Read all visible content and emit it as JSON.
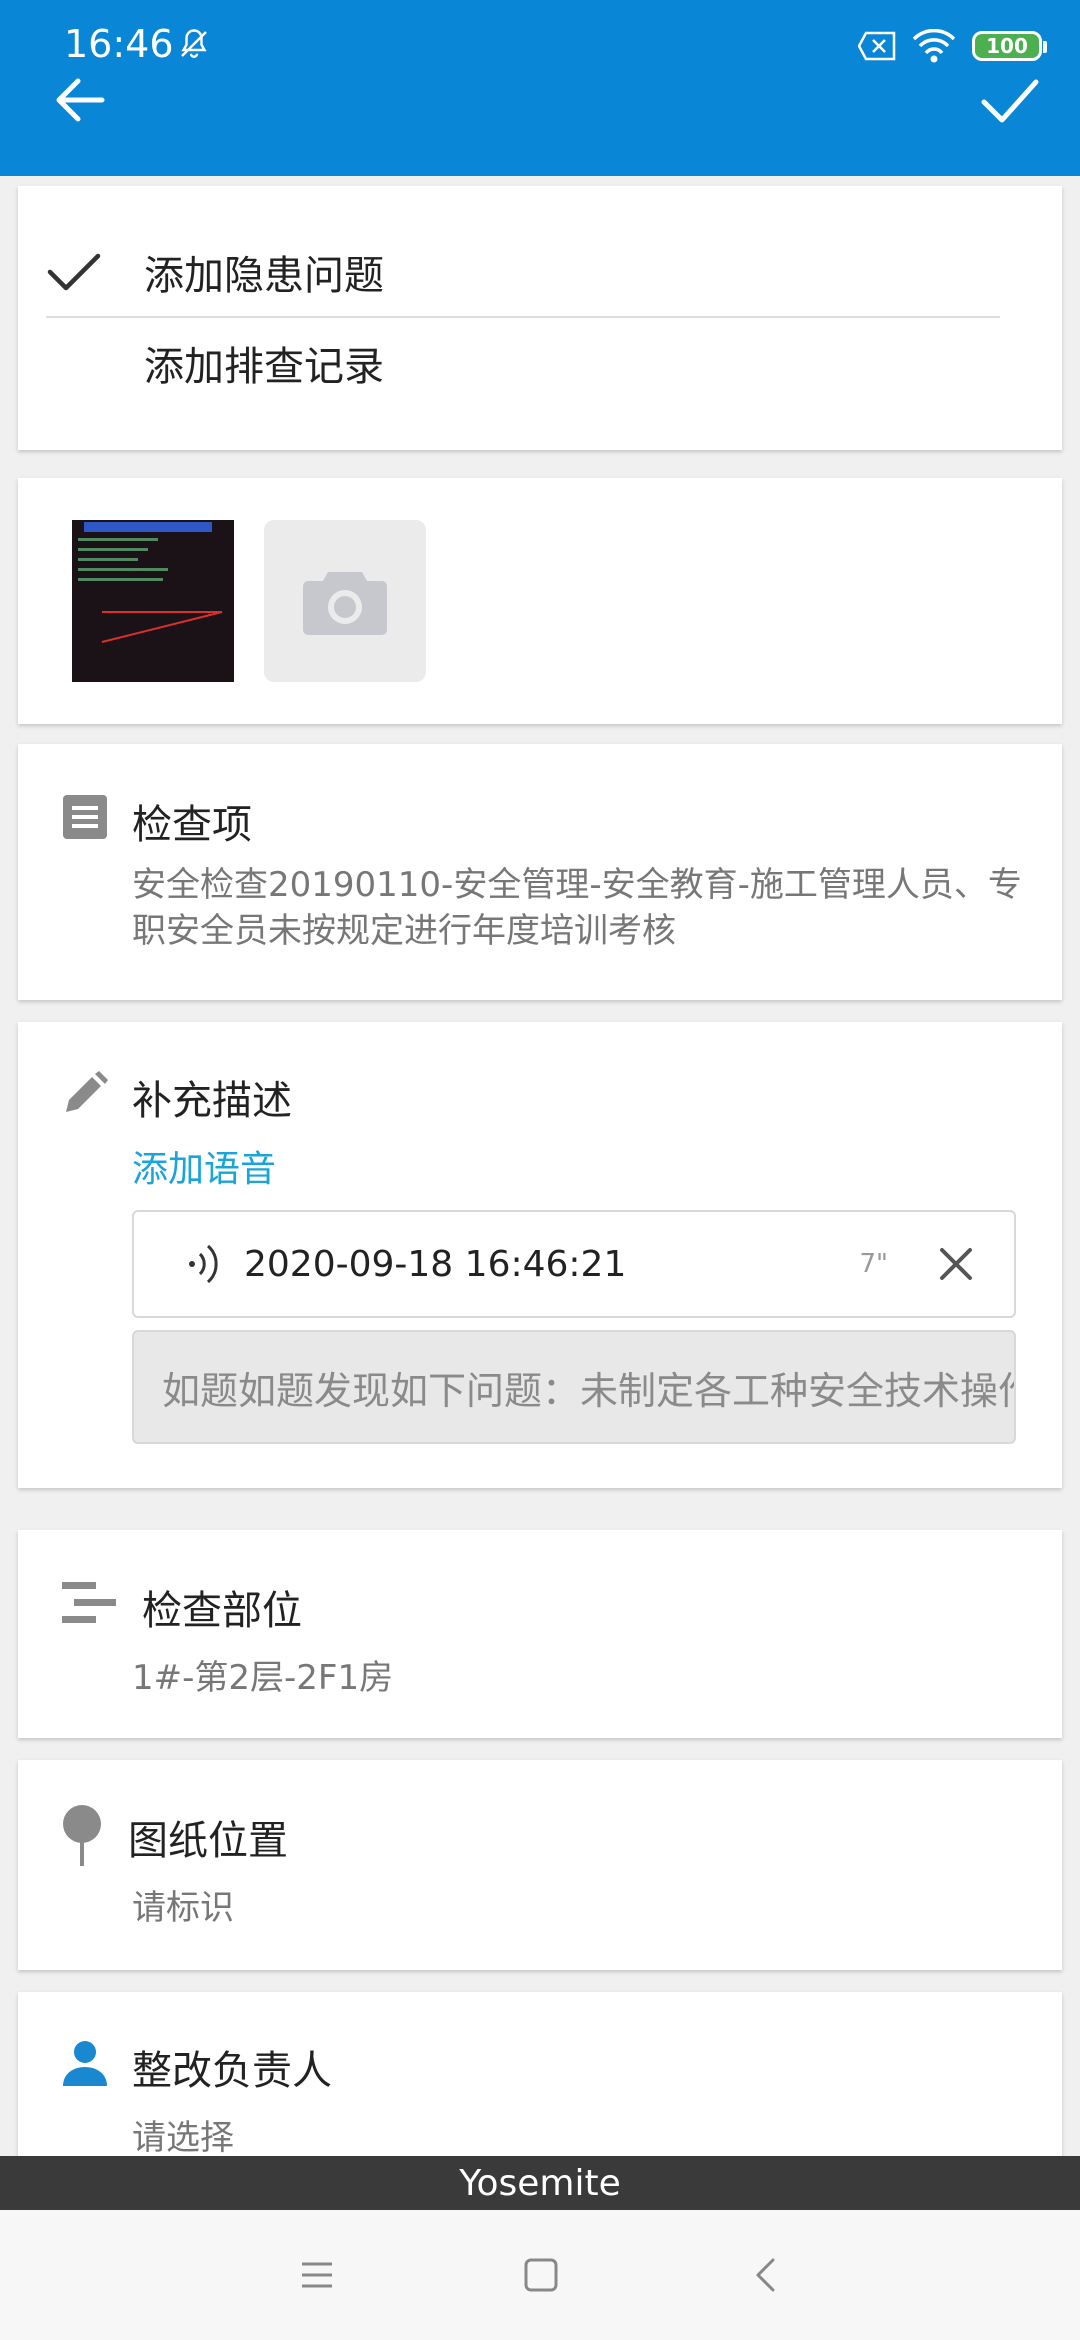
{
  "status_bar": {
    "time": "16:46",
    "battery": "100"
  },
  "check_type": {
    "options": [
      {
        "label": "添加隐患问题",
        "selected": true
      },
      {
        "label": "添加排查记录",
        "selected": false
      }
    ]
  },
  "check_item": {
    "title": "检查项",
    "value": "安全检查20190110-安全管理-安全教育-施工管理人员、专职安全员未按规定进行年度培训考核"
  },
  "description": {
    "title": "补充描述",
    "add_voice": "添加语音",
    "voice": {
      "timestamp": "2020-09-18 16:46:21",
      "duration": "7\""
    },
    "text": "如题如题发现如下问题：未制定各工种安全技术操作规程"
  },
  "check_part": {
    "title": "检查部位",
    "value": "1#-第2层-2F1房"
  },
  "drawing_position": {
    "title": "图纸位置",
    "value": "请标识"
  },
  "owner": {
    "title": "整改负责人",
    "value": "请选择"
  },
  "toast": "Yosemite",
  "colors": {
    "primary": "#0a86d6",
    "link": "#1aa4d8",
    "owner_icon": "#1a88d0",
    "battery": "#4caf50"
  }
}
